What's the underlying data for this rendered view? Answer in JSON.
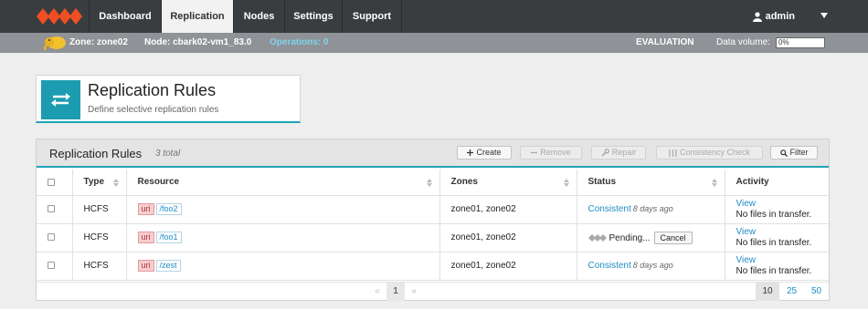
{
  "nav": {
    "tabs": [
      {
        "label": "Dashboard"
      },
      {
        "label": "Replication"
      },
      {
        "label": "Nodes"
      },
      {
        "label": "Settings"
      },
      {
        "label": "Support"
      }
    ],
    "active_tab": "Replication",
    "user": "admin"
  },
  "statusbar": {
    "zone": "Zone: zone02",
    "node": "Node: cbark02-vm1_83.0",
    "operations": "Operations: 0",
    "license": "EVALUATION",
    "data_volume_label": "Data volume:",
    "data_volume_value": "0%"
  },
  "header": {
    "title": "Replication Rules",
    "subtitle": "Define selective replication rules"
  },
  "panel": {
    "title": "Replication Rules",
    "count": "3 total",
    "buttons": {
      "create": "Create",
      "remove": "Remove",
      "repair": "Repair",
      "consistency": "Consistency Check",
      "filter": "Filter"
    }
  },
  "table": {
    "columns": {
      "type": "Type",
      "resource": "Resource",
      "zones": "Zones",
      "status": "Status",
      "activity": "Activity"
    },
    "rows": [
      {
        "type": "HCFS",
        "uri": "uri",
        "path": "/foo2",
        "zones": "zone01, zone02",
        "status": "Consistent",
        "status_ago": "8 days ago",
        "activity_link": "View",
        "activity_text": "No files in transfer."
      },
      {
        "type": "HCFS",
        "uri": "uri",
        "path": "/foo1",
        "zones": "zone01, zone02",
        "status": "Pending...",
        "cancel": "Cancel",
        "activity_link": "View",
        "activity_text": "No files in transfer."
      },
      {
        "type": "HCFS",
        "uri": "uri",
        "path": "/zest",
        "zones": "zone01, zone02",
        "status": "Consistent",
        "status_ago": "8 days ago",
        "activity_link": "View",
        "activity_text": "No files in transfer."
      }
    ]
  },
  "pager": {
    "prev": "«",
    "page": "1",
    "next": "»",
    "sizes": [
      "10",
      "25",
      "50"
    ],
    "selected_size": "10"
  },
  "colors": {
    "accent": "#1fa4b8",
    "link": "#1e8dc5",
    "logo": "#f04e23",
    "nav_bg": "#3a3d40"
  }
}
